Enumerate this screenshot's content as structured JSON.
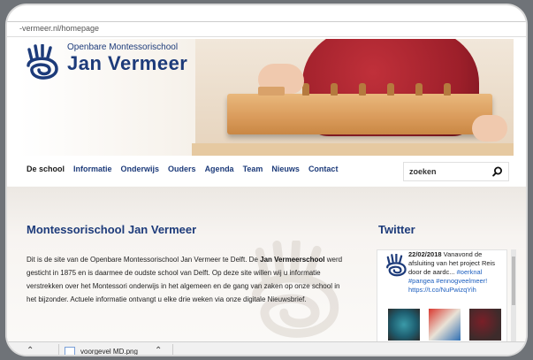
{
  "browser": {
    "url": "-vermeer.nl/homepage"
  },
  "header": {
    "logo_top": "Openbare Montessorischool",
    "logo_name": "Jan Vermeer"
  },
  "nav": {
    "items": [
      "De school",
      "Informatie",
      "Onderwijs",
      "Ouders",
      "Agenda",
      "Team",
      "Nieuws",
      "Contact"
    ],
    "active_index": 0
  },
  "search": {
    "placeholder": "zoeken"
  },
  "main": {
    "title": "Montessorischool Jan Vermeer",
    "intro_part1": "Dit is de site van de Openbare Montessorischool Jan Vermeer te Delft. De ",
    "intro_bold": "Jan Vermeerschool",
    "intro_part2": " werd gesticht in 1875 en is daarmee de oudste school van Delft. Op deze site willen wij u informatie verstrekken over het Montessori onderwijs in het algemeen en de gang van zaken op onze school in het bijzonder. Actuele informatie ontvangt u elke drie weken via onze digitale Nieuwsbrief."
  },
  "twitter": {
    "title": "Twitter",
    "tweet_date": "22/02/2018",
    "tweet_text": " Vanavond de afsluiting van het project Reis door de aardc... ",
    "tweet_links": [
      "#oerknal",
      "#pangea",
      "#ennogveelmeer!",
      "https://t.co/NuPwizqYih"
    ]
  },
  "downloads": {
    "file_name": "voorgevel MD.png"
  },
  "colors": {
    "brand": "#1d3b7a",
    "link": "#1d5fbf"
  }
}
